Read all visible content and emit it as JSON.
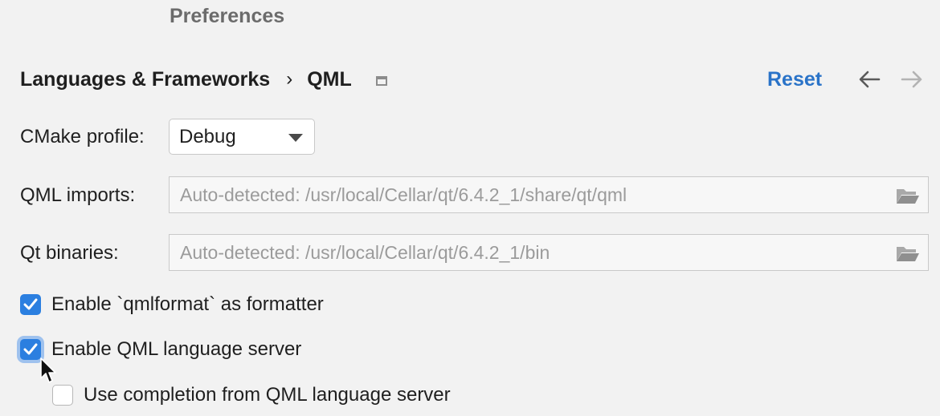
{
  "window": {
    "title": "Preferences"
  },
  "header": {
    "breadcrumb": [
      "Languages & Frameworks",
      "QML"
    ],
    "separator": "›",
    "reset_label": "Reset"
  },
  "form": {
    "cmake_profile": {
      "label": "CMake profile:",
      "value": "Debug"
    },
    "qml_imports": {
      "label": "QML imports:",
      "placeholder": "Auto-detected: /usr/local/Cellar/qt/6.4.2_1/share/qt/qml"
    },
    "qt_binaries": {
      "label": "Qt binaries:",
      "placeholder": "Auto-detected: /usr/local/Cellar/qt/6.4.2_1/bin"
    },
    "checkboxes": [
      {
        "label": "Enable `qmlformat` as formatter",
        "checked": true
      },
      {
        "label": "Enable QML language server",
        "checked": true
      },
      {
        "label": "Use completion from QML language server",
        "checked": false
      }
    ]
  },
  "colors": {
    "accent": "#2b7fe0",
    "link": "#2a73c8",
    "background": "#f2f2f2"
  }
}
